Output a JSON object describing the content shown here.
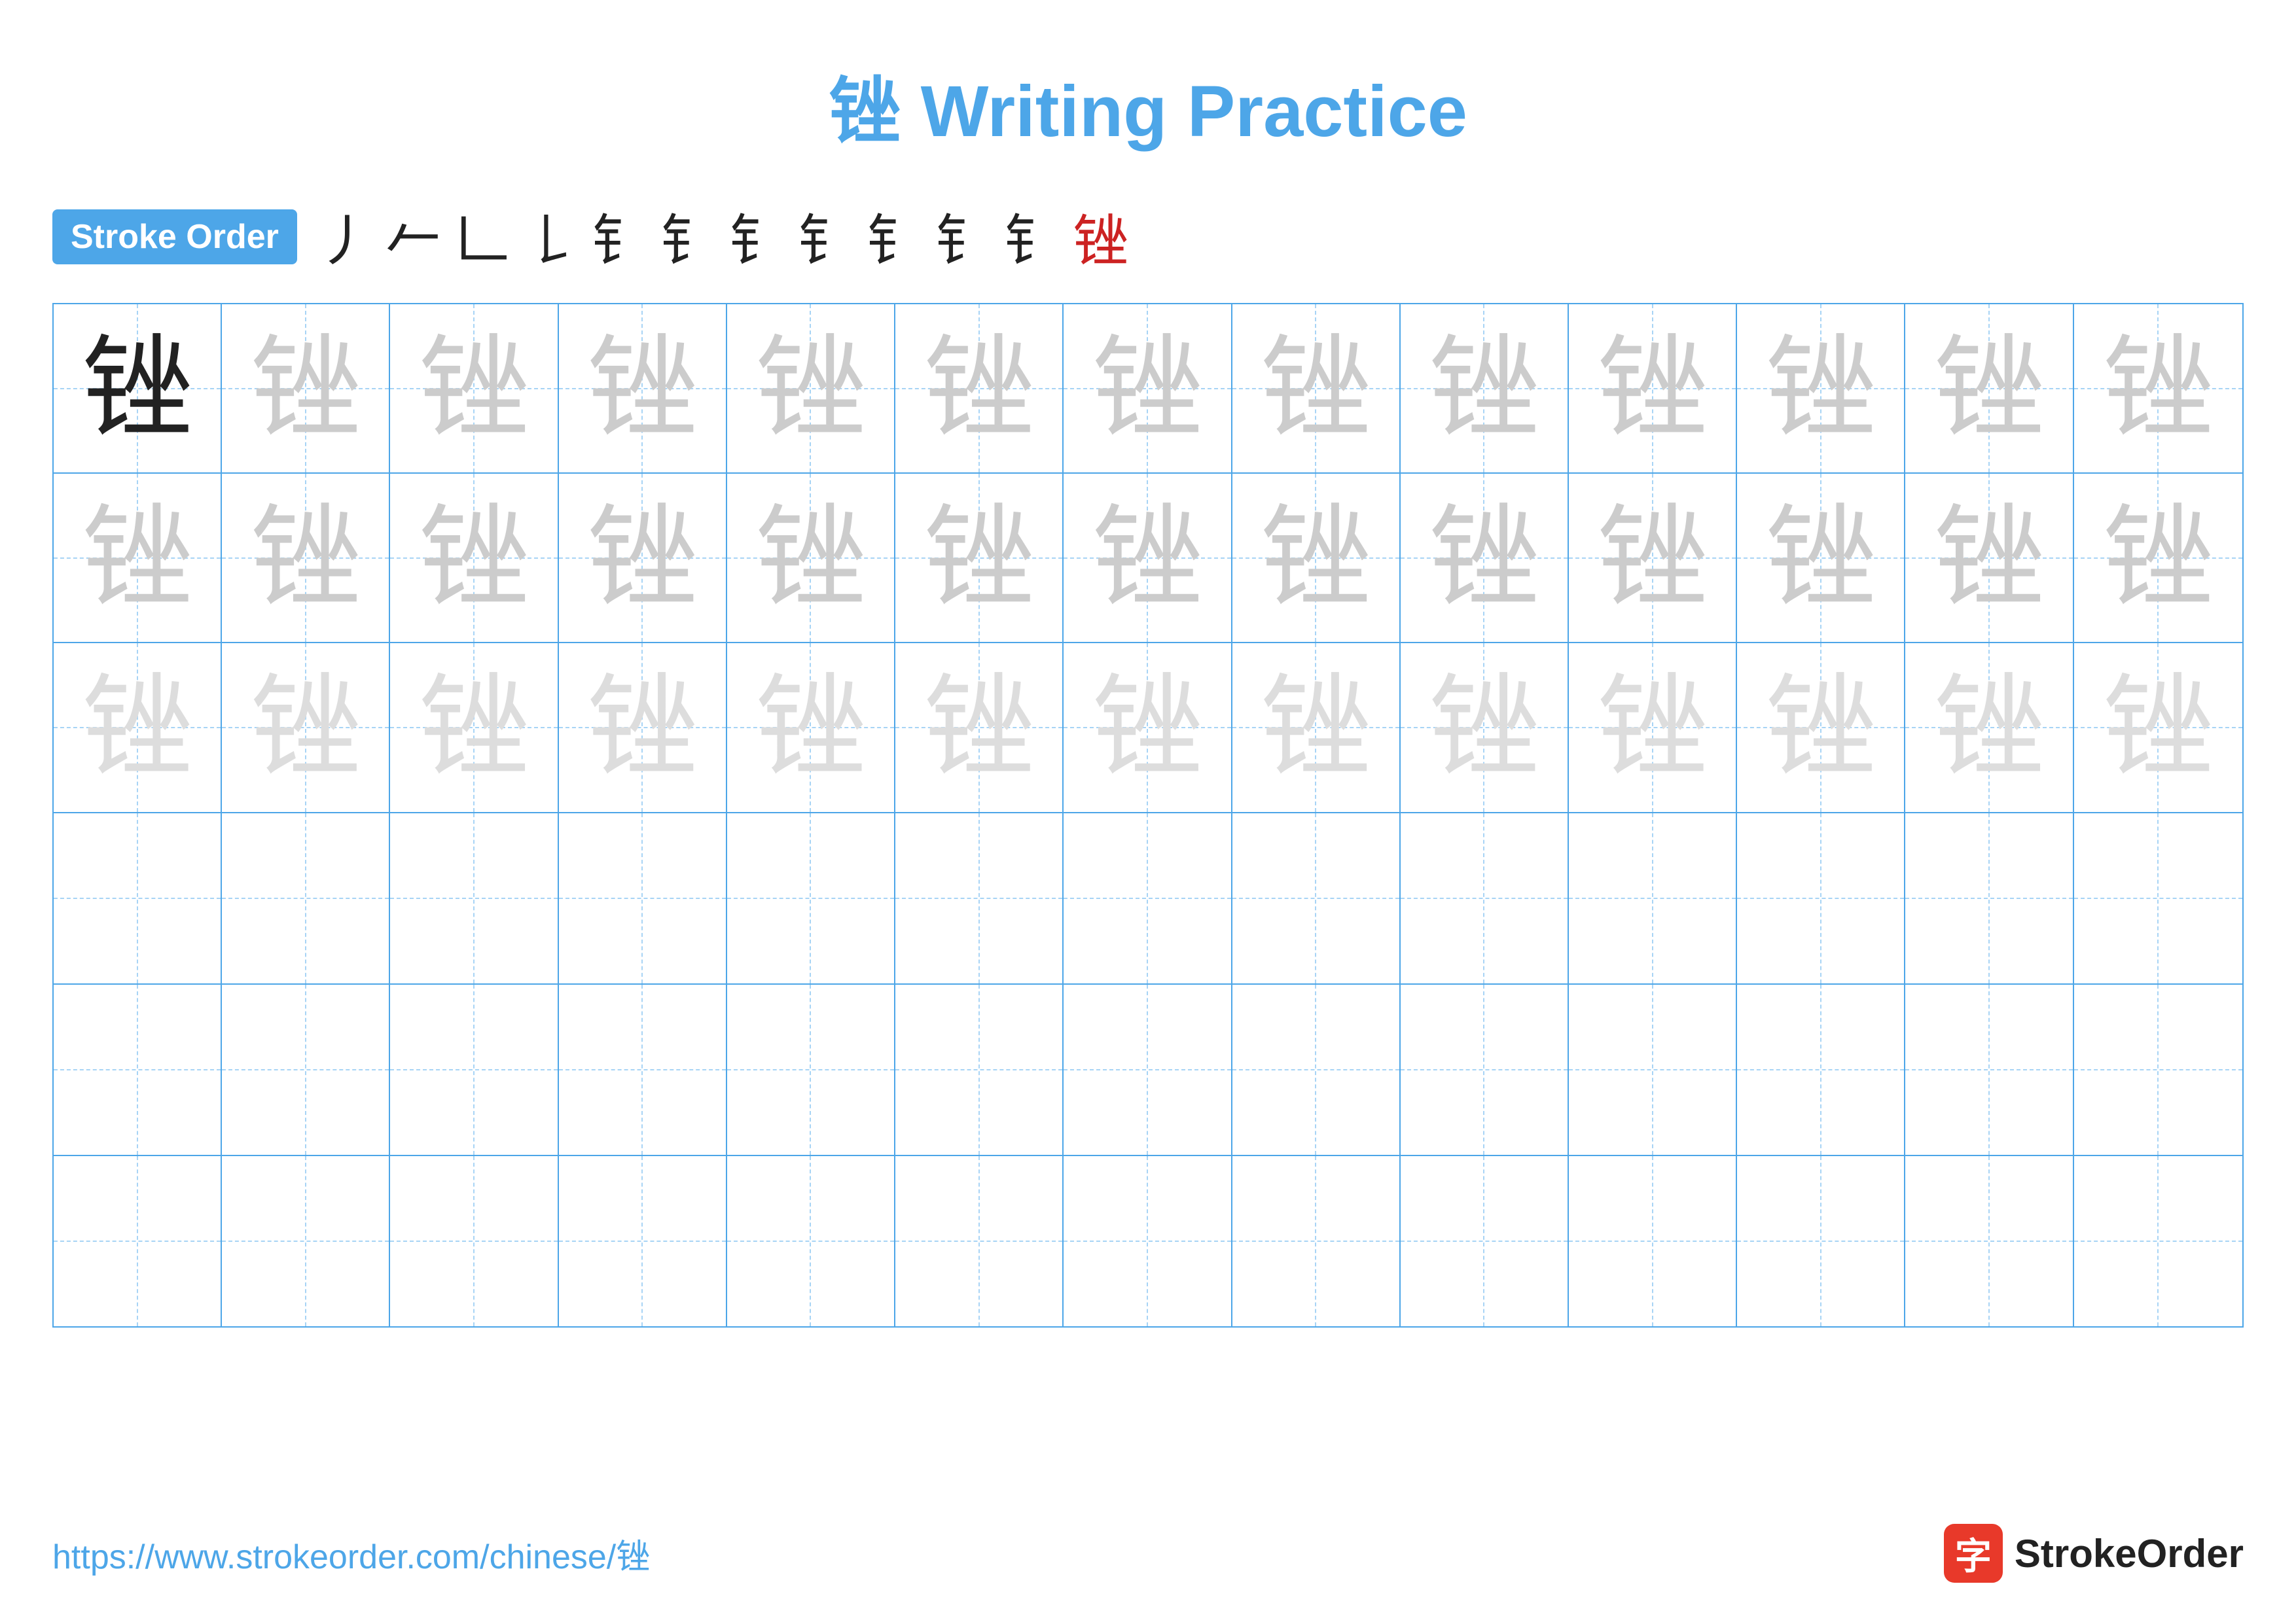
{
  "title": {
    "char": "锉",
    "text": "Writing Practice"
  },
  "stroke_order": {
    "badge_label": "Stroke Order",
    "strokes": [
      "丿",
      "𠂉",
      "𠃊",
      "𠄌",
      "钅",
      "钅",
      "钅",
      "钅",
      "钅",
      "钅",
      "钅",
      "锉"
    ]
  },
  "grid": {
    "rows": 6,
    "cols": 13,
    "char": "锉"
  },
  "footer": {
    "url": "https://www.strokeorder.com/chinese/锉",
    "logo_char": "字",
    "logo_text": "StrokeOrder"
  }
}
